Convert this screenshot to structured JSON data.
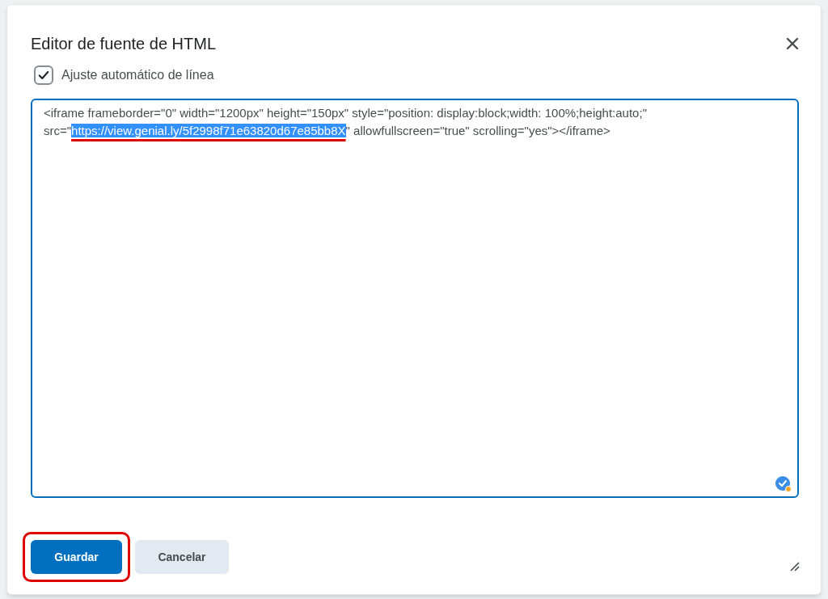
{
  "dialog": {
    "title": "Editor de fuente de HTML"
  },
  "word_wrap": {
    "label": "Ajuste automático de línea",
    "checked": true
  },
  "editor": {
    "before": "<iframe frameborder=\"0\" width=\"1200px\" height=\"150px\" style=\"position: display:block;width: 100%;height:auto;\" src=\"",
    "selection": "https://view.genial.ly/5f2998f71e63820d67e85bb8X",
    "after": "\" allowfullscreen=\"true\" scrolling=\"yes\"></iframe>",
    "selection_underlined": true
  },
  "buttons": [
    {
      "label": "Guardar",
      "kind": "primary",
      "highlighted": true
    },
    {
      "label": "Cancelar",
      "kind": "secondary",
      "highlighted": false
    }
  ]
}
